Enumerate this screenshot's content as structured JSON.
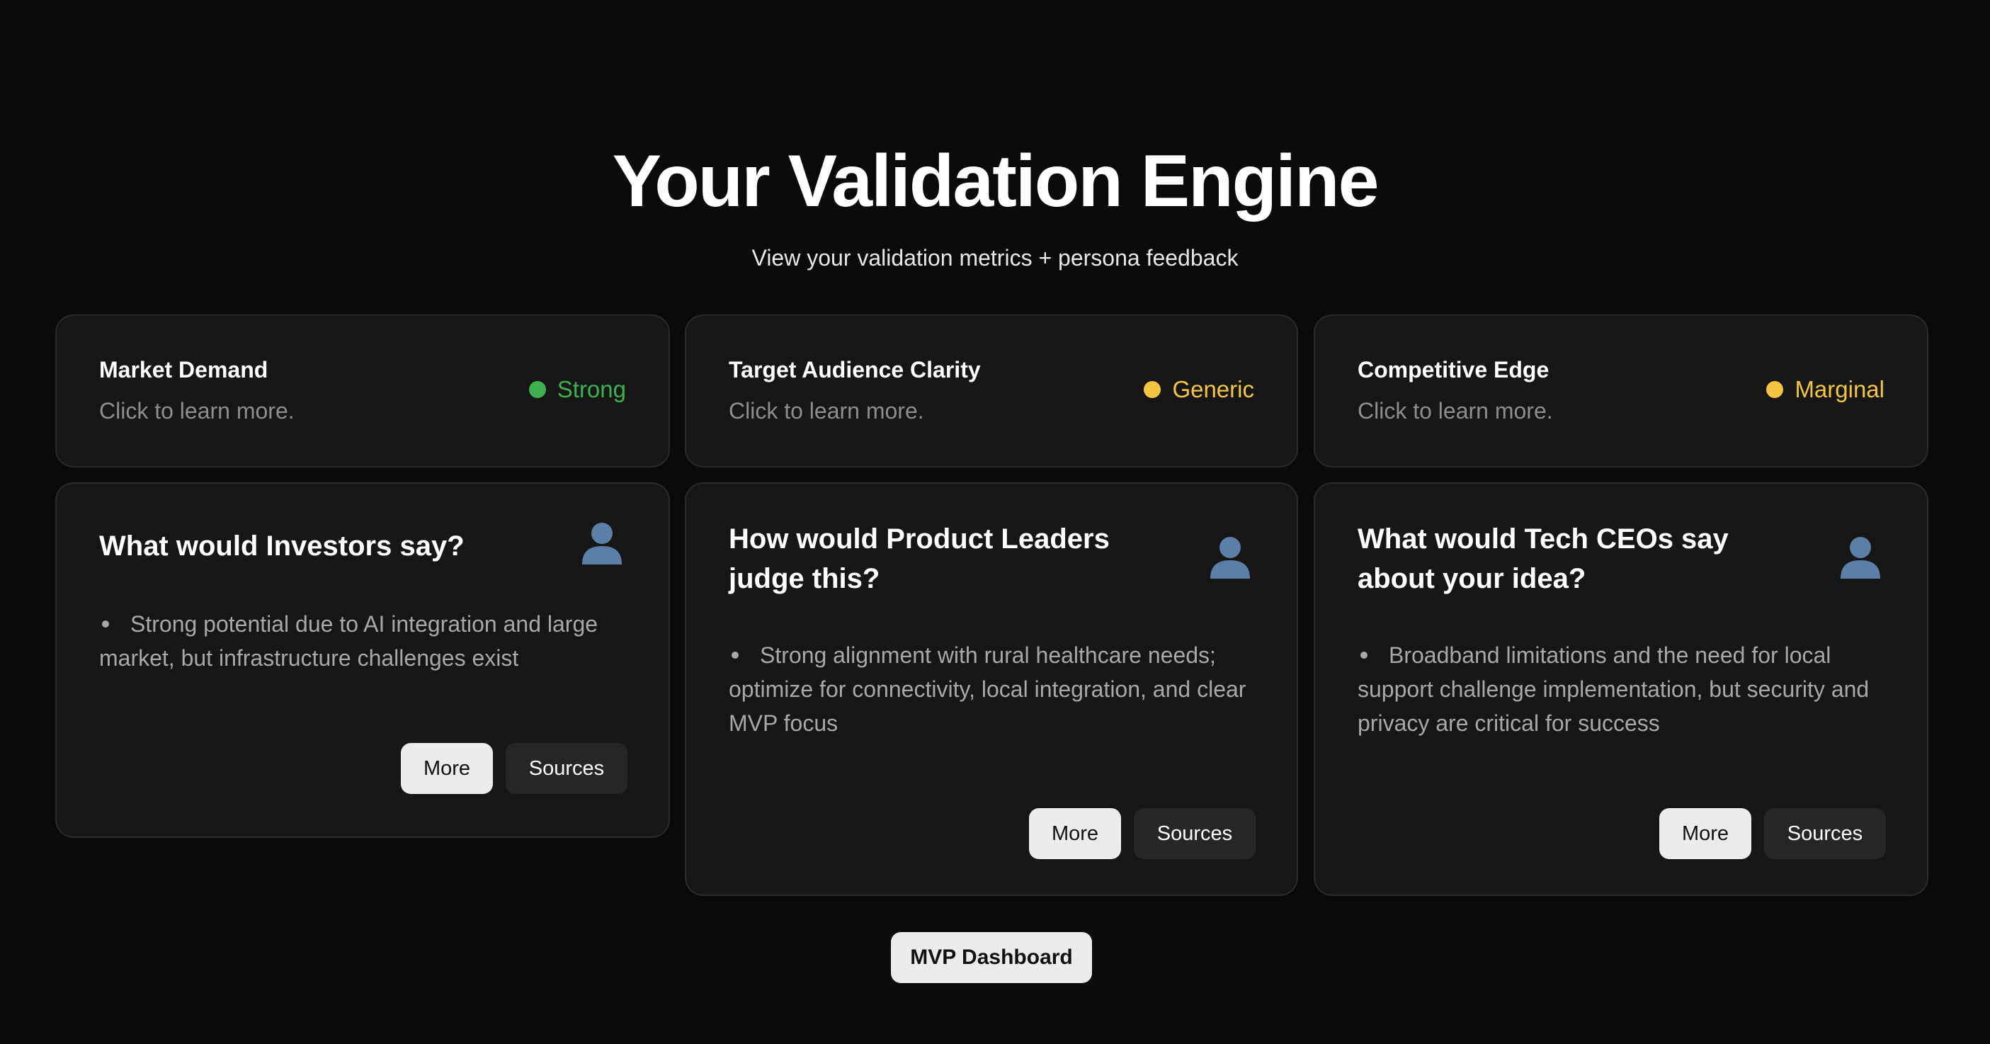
{
  "header": {
    "title": "Your Validation Engine",
    "subtitle": "View your validation metrics + persona feedback"
  },
  "metrics": [
    {
      "title": "Market Demand",
      "subtitle": "Click to learn more.",
      "status": "Strong",
      "status_color": "#3fb04f"
    },
    {
      "title": "Target Audience Clarity",
      "subtitle": "Click to learn more.",
      "status": "Generic",
      "status_color": "#f5c542"
    },
    {
      "title": "Competitive Edge",
      "subtitle": "Click to learn more.",
      "status": "Marginal",
      "status_color": "#f5c542"
    }
  ],
  "personas": [
    {
      "question": "What would Investors say?",
      "icon": "person-icon",
      "bullet": "Strong potential due to AI integration and large market, but infrastructure challenges exist",
      "more_label": "More",
      "sources_label": "Sources"
    },
    {
      "question": "How would Product Leaders judge this?",
      "icon": "person-icon",
      "bullet": "Strong alignment with rural healthcare needs; optimize for connectivity, local integration, and clear MVP focus",
      "more_label": "More",
      "sources_label": "Sources"
    },
    {
      "question": "What would Tech CEOs say about your idea?",
      "icon": "person-icon",
      "bullet": "Broadband limitations and the need for local support challenge implementation, but security and privacy are critical for success",
      "more_label": "More",
      "sources_label": "Sources"
    }
  ],
  "footer": {
    "mvp_label": "MVP Dashboard"
  },
  "colors": {
    "background": "#0a0a0a",
    "card": "#161616",
    "persona_icon": "#5b7fa6"
  }
}
